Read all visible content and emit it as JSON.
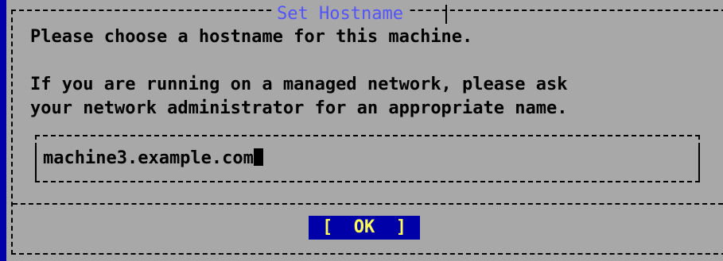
{
  "dialog": {
    "title": "Set Hostname",
    "line1": "Please choose a hostname for this machine.",
    "line2": "If you are running on a managed network, please ask",
    "line3": "your network administrator for an appropriate name."
  },
  "hostname_input": {
    "value": "machine3.example.com"
  },
  "buttons": {
    "ok_label": "[  OK  ]"
  },
  "colors": {
    "background": "#0000a8",
    "dialog": "#a8a8a8",
    "title": "#5454fc",
    "button_bg": "#0000a8",
    "button_text": "#fcfc54"
  }
}
